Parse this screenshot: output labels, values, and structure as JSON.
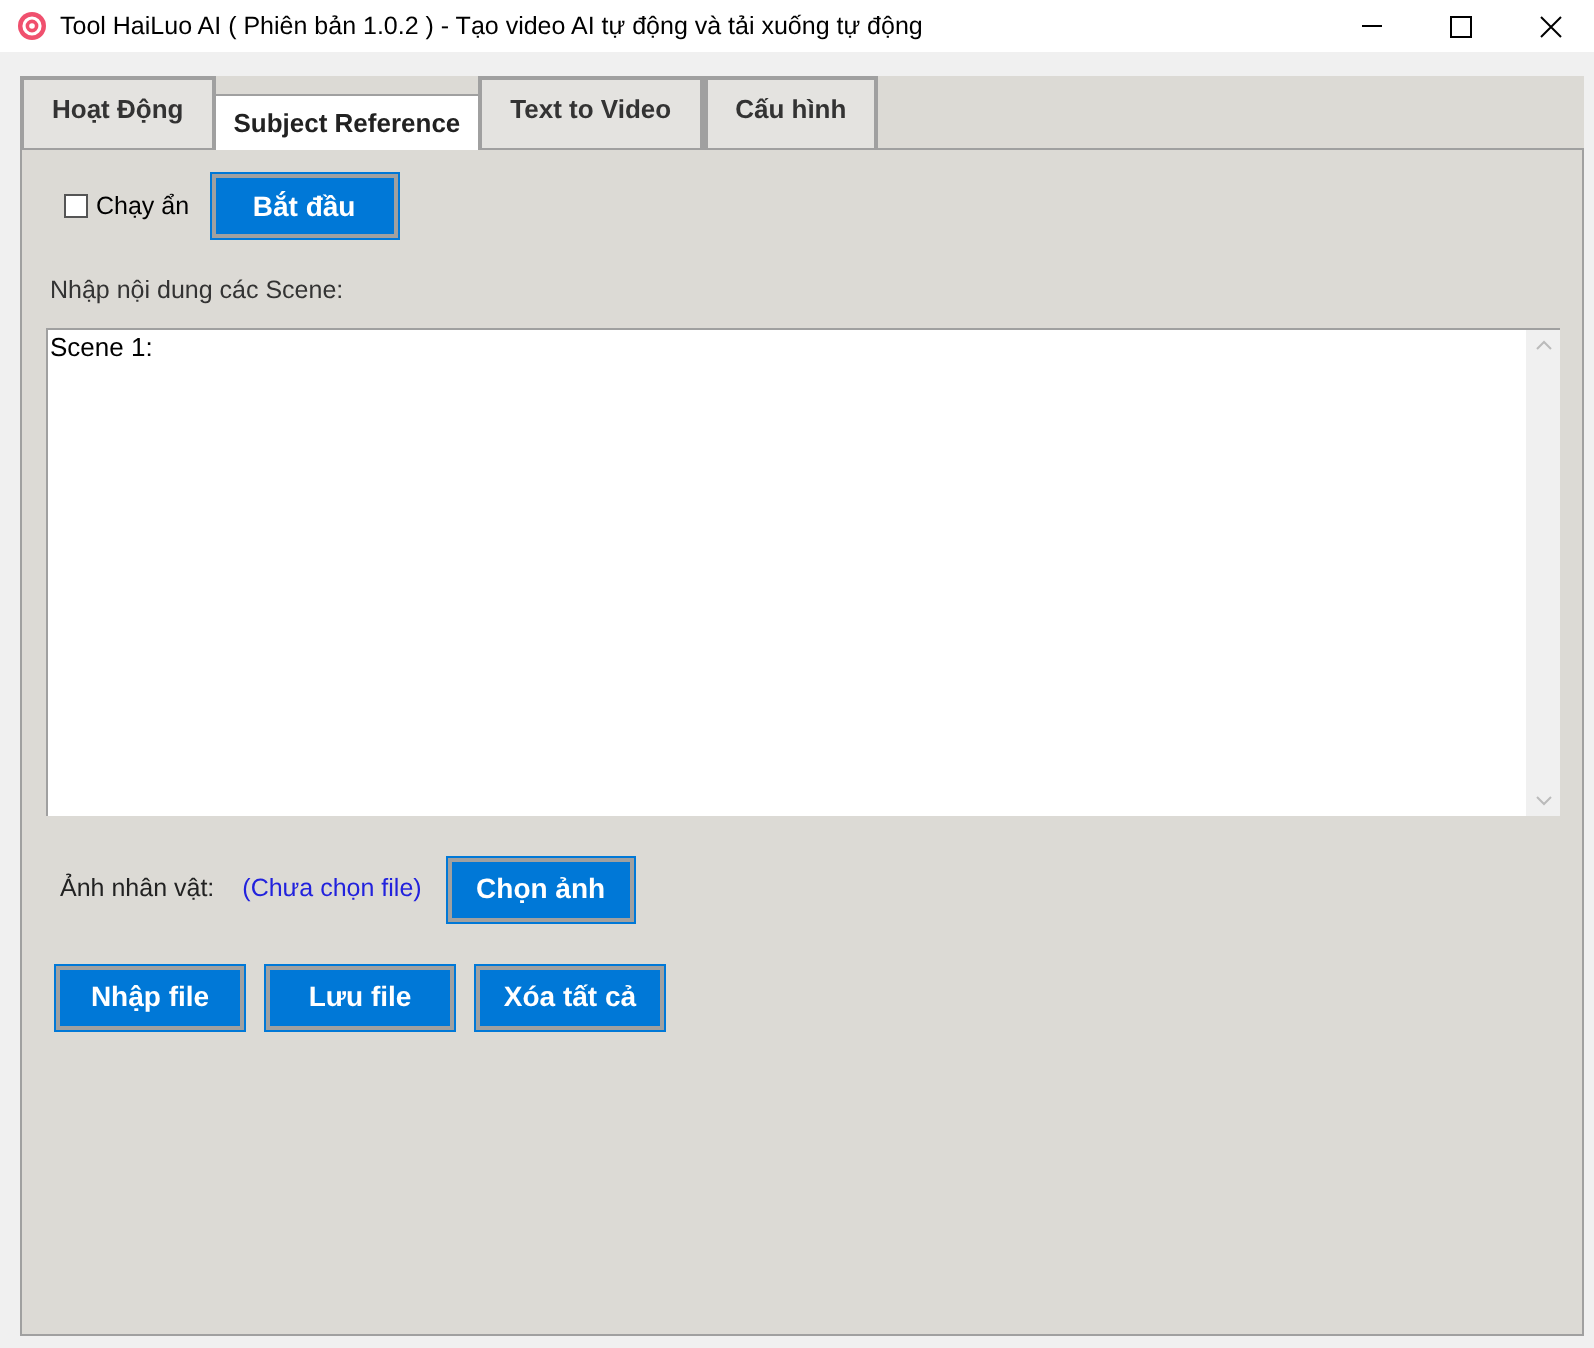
{
  "window": {
    "title": "Tool HaiLuo AI ( Phiên bản 1.0.2 ) - Tạo video AI tự động và tải xuống tự động"
  },
  "tabs": [
    {
      "label": "Hoạt Động",
      "selected": false
    },
    {
      "label": "Subject Reference",
      "selected": true
    },
    {
      "label": "Text to Video",
      "selected": false
    },
    {
      "label": "Cấu hình",
      "selected": false
    }
  ],
  "hidden_run": {
    "label": "Chạy ẩn",
    "checked": false
  },
  "start_button": "Bắt đầu",
  "scenes": {
    "label": "Nhập nội dung các Scene:",
    "value": "Scene 1:"
  },
  "character_image": {
    "label": "Ảnh nhân vật:",
    "status": "(Chưa chọn file)",
    "button": "Chọn ảnh"
  },
  "buttons": [
    "Nhập file",
    "Lưu file",
    "Xóa tất cả"
  ]
}
